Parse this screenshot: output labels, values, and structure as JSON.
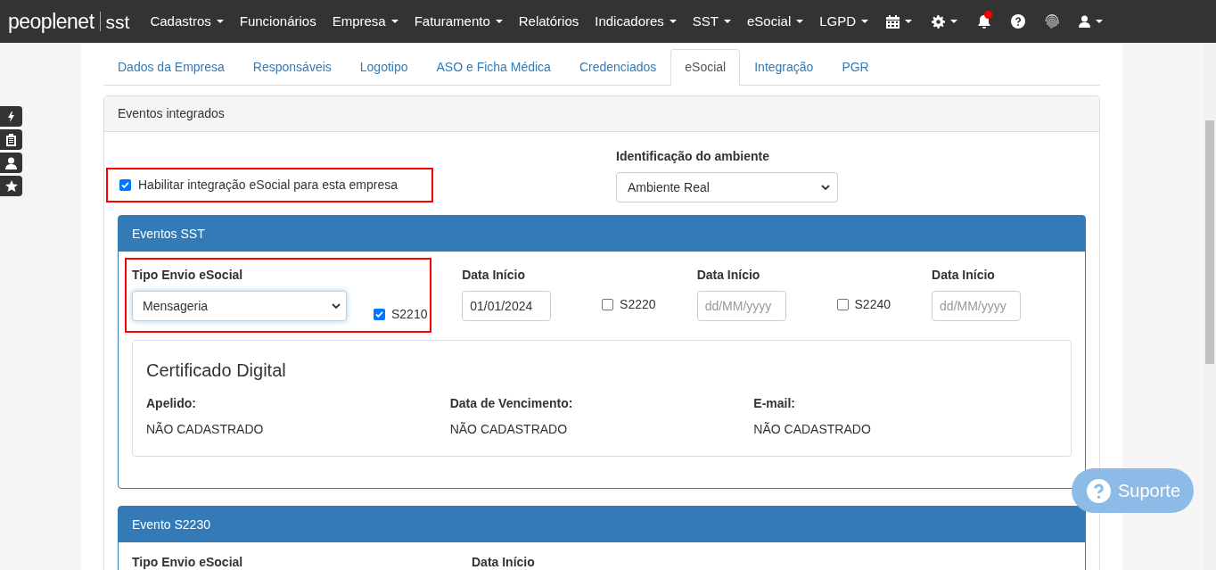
{
  "navbar": {
    "brand": {
      "name": "peoplenet",
      "product": "sst"
    },
    "items": [
      {
        "kind": "text",
        "label": "Cadastros",
        "dropdown": true
      },
      {
        "kind": "text",
        "label": "Funcionários",
        "dropdown": false
      },
      {
        "kind": "text",
        "label": "Empresa",
        "dropdown": true
      },
      {
        "kind": "text",
        "label": "Faturamento",
        "dropdown": true
      },
      {
        "kind": "text",
        "label": "Relatórios",
        "dropdown": false
      },
      {
        "kind": "text",
        "label": "Indicadores",
        "dropdown": true
      },
      {
        "kind": "text",
        "label": "SST",
        "dropdown": true
      },
      {
        "kind": "text",
        "label": "eSocial",
        "dropdown": true
      },
      {
        "kind": "text",
        "label": "LGPD",
        "dropdown": true
      },
      {
        "kind": "calendar",
        "dropdown": true
      },
      {
        "kind": "gear",
        "dropdown": true
      },
      {
        "kind": "bell",
        "dropdown": false,
        "badge": true
      },
      {
        "kind": "help",
        "dropdown": false
      },
      {
        "kind": "fingerprint",
        "dropdown": false
      },
      {
        "kind": "user",
        "dropdown": true
      }
    ]
  },
  "tabs": [
    {
      "label": "Dados da Empresa",
      "selected": false
    },
    {
      "label": "Responsáveis",
      "selected": false
    },
    {
      "label": "Logotipo",
      "selected": false
    },
    {
      "label": "ASO e Ficha Médica",
      "selected": false
    },
    {
      "label": "Credenciados",
      "selected": false
    },
    {
      "label": "eSocial",
      "selected": true
    },
    {
      "label": "Integração",
      "selected": false
    },
    {
      "label": "PGR",
      "selected": false
    }
  ],
  "panel": {
    "title": "Eventos integrados",
    "enable": {
      "label": "Habilitar integração eSocial para esta empresa",
      "checked": true,
      "highlighted": true
    },
    "environment": {
      "label": "Identificação do ambiente",
      "value": "Ambiente Real"
    },
    "sst": {
      "title": "Eventos SST",
      "send_type": {
        "label": "Tipo Envio eSocial",
        "value": "Mensageria",
        "highlighted": true
      },
      "events": [
        {
          "code": "S2210",
          "checked": true,
          "date_label": "Data Início",
          "date_value": "01/01/2024"
        },
        {
          "code": "S2220",
          "checked": false,
          "date_label": "Data Início",
          "placeholder": "dd/MM/yyyy"
        },
        {
          "code": "S2240",
          "checked": false,
          "date_label": "Data Início",
          "placeholder": "dd/MM/yyyy"
        }
      ],
      "certificate": {
        "title": "Certificado Digital",
        "fields": [
          {
            "label": "Apelido:",
            "value": "NÃO CADASTRADO"
          },
          {
            "label": "Data de Vencimento:",
            "value": "NÃO CADASTRADO"
          },
          {
            "label": "E-mail:",
            "value": "NÃO CADASTRADO"
          }
        ]
      }
    },
    "s2230": {
      "title": "Evento S2230",
      "labels": [
        "Tipo Envio eSocial",
        "Data Início"
      ]
    }
  },
  "support": {
    "label": "Suporte"
  }
}
